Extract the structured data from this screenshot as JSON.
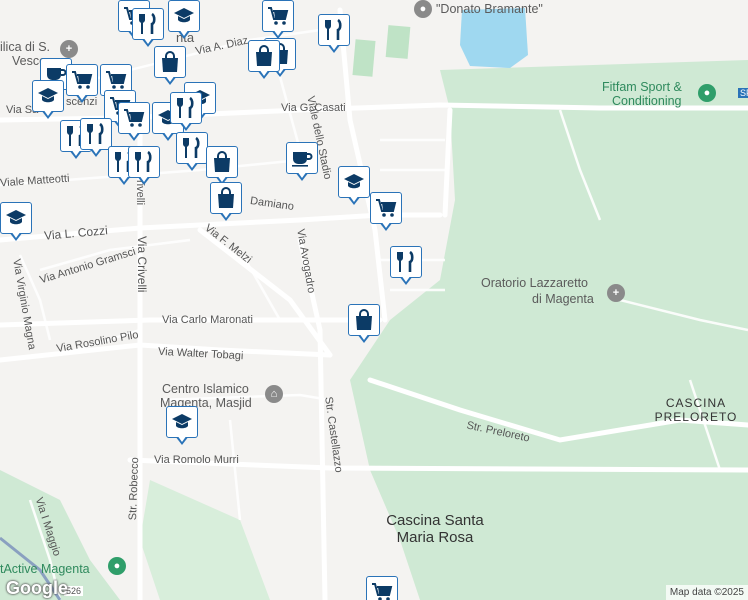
{
  "labels": {
    "donato": "\"Donato Bramante\"",
    "fitfam": "Fitfam Sport &",
    "fitfam2": "Conditioning",
    "oratorio1": "Oratorio Lazzaretto",
    "oratorio2": "di Magenta",
    "cascina_preloreto1": "CASCINA",
    "cascina_preloreto2": "PRELORETO",
    "cascina_santa1": "Cascina Santa",
    "cascina_santa2": "Maria Rosa",
    "centro1": "Centro Islamico",
    "centro2": "Magenta, Masjid",
    "factive": "tActive Magenta",
    "town_fragment": "nta",
    "basilica": "ilica di S.",
    "basilica2": "Vesco"
  },
  "roads": {
    "via_casati": "Via G. Casati",
    "viale_stadio": "Viale dello Stadio",
    "via_a_diaz": "Via A. Diaz",
    "viale_matteotti": "Viale Matteotti",
    "damiano": "Damiano",
    "via_cozzi": "Via L. Cozzi",
    "via_gramsci": "Via Antonio Gramsci",
    "via_virginio_magna": "Via Virginio Magna",
    "via_melzi": "Via F. Melzi",
    "via_avogadro": "Via Avogadro",
    "via_crivelli": "Via Crivelli",
    "crivelli_top": "rivelli",
    "via_maronati": "Via Carlo Maronati",
    "via_rosolino": "Via Rosolino Pilo",
    "via_tobagi": "Via Walter Tobagi",
    "str_castellazzo": "Str. Castellazzo",
    "str_preloreto": "Str. Preloreto",
    "via_murri": "Via Romolo Murri",
    "str_robecco": "Str. Robecco",
    "via_maggio": "Via I Maggio",
    "via_sa": "Via Sa",
    "scenzi": "scenzi",
    "road_526": "526",
    "sp": "SP"
  },
  "attribution": {
    "google": "Google",
    "map_data": "Map data ©2025"
  },
  "colors": {
    "pin_border": "#2a73b8",
    "icon_navy": "#0c3b66",
    "park_green": "#cfe9d4",
    "water": "#9fd8f0",
    "poi_green": "#2f9e6a",
    "poi_grey": "#8a8a8a"
  },
  "markers": [
    {
      "type": "shopping-cart"
    },
    {
      "type": "restaurant"
    },
    {
      "type": "school"
    },
    {
      "type": "shopping-bag"
    },
    {
      "type": "shopping-cart"
    },
    {
      "type": "coffee"
    },
    {
      "type": "school"
    },
    {
      "type": "shopping-cart"
    },
    {
      "type": "restaurant"
    },
    {
      "type": "shopping-bag"
    },
    {
      "type": "school"
    },
    {
      "type": "shopping-cart"
    }
  ]
}
